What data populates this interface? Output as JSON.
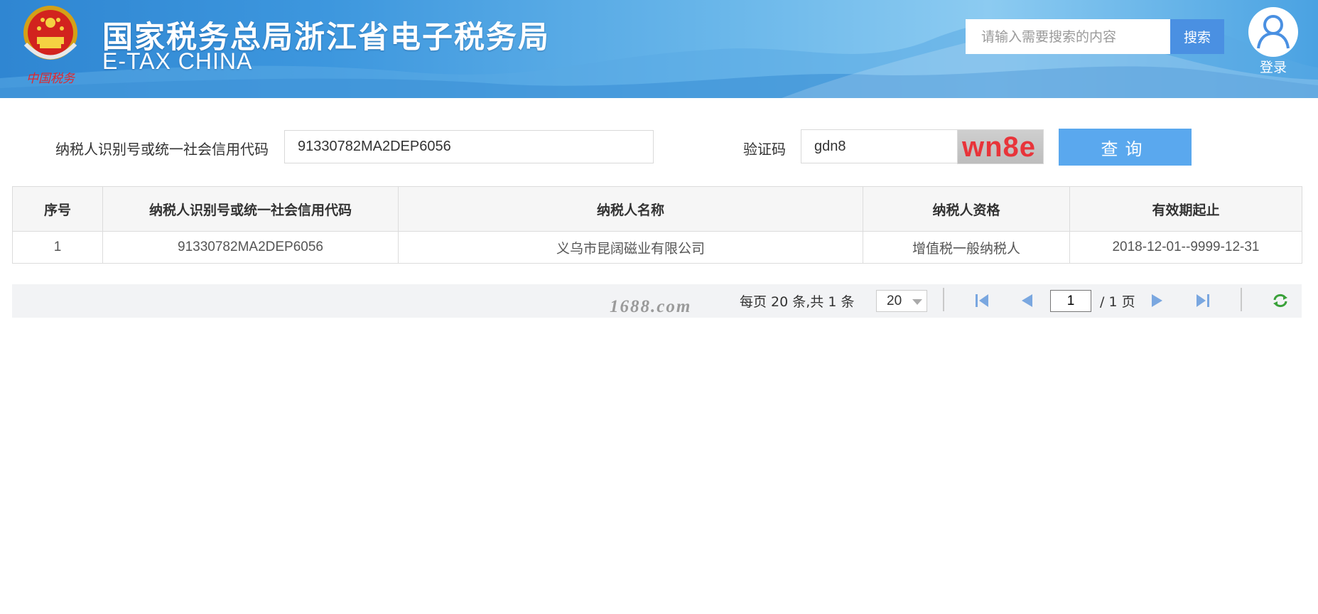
{
  "header": {
    "title_cn": "国家税务总局浙江省电子税务局",
    "title_en": "E-TAX CHINA",
    "emblem_caption": "中国税务",
    "search_placeholder": "请输入需要搜索的内容",
    "search_button": "搜索",
    "login_label": "登录"
  },
  "form": {
    "taxid_label": "纳税人识别号或统一社会信用代码",
    "taxid_value": "91330782MA2DEP6056",
    "captcha_label": "验证码",
    "captcha_value": "gdn8",
    "captcha_image_text": "wn8e",
    "query_button": "查询"
  },
  "table": {
    "headers": [
      "序号",
      "纳税人识别号或统一社会信用代码",
      "纳税人名称",
      "纳税人资格",
      "有效期起止"
    ],
    "rows": [
      [
        "1",
        "91330782MA2DEP6056",
        "义乌市昆阔磁业有限公司",
        "增值税一般纳税人",
        "2018-12-01--9999-12-31"
      ]
    ]
  },
  "pager": {
    "watermark": "1688.com",
    "info": "每页 20 条,共 1 条",
    "page_size": "20",
    "current_page": "1",
    "total_pages": "/ 1 页"
  },
  "icons": {
    "first": "first-page-icon",
    "prev": "prev-page-icon",
    "next": "next-page-icon",
    "last": "last-page-icon",
    "refresh": "refresh-icon",
    "user": "user-icon",
    "emblem": "national-emblem-icon"
  },
  "colors": {
    "search_button": "#4a90e2",
    "query_button": "#5aa8ee",
    "captcha_text": "#e8343a",
    "pager_icon": "#7aa7e0",
    "refresh_icon": "#3aa13a"
  }
}
